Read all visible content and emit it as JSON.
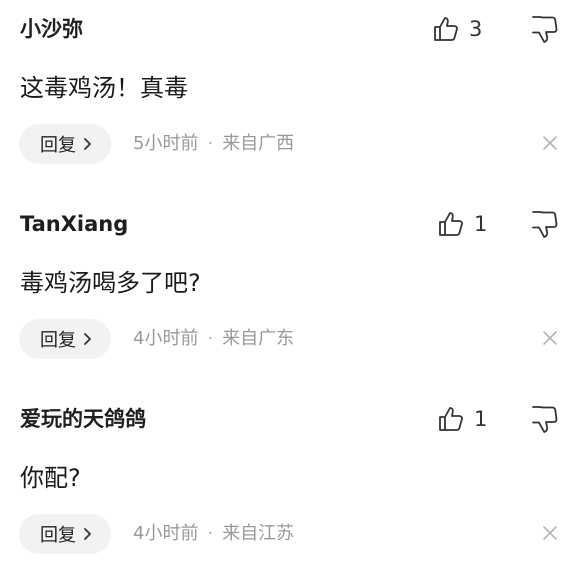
{
  "comments": [
    {
      "username": "小沙弥",
      "like_count": "3",
      "content": "这毒鸡汤！真毒",
      "reply_label": "回复",
      "time": "5小时前",
      "separator": "·",
      "location": "来自广西"
    },
    {
      "username": "TanXiang",
      "like_count": "1",
      "content": "毒鸡汤喝多了吧?",
      "reply_label": "回复",
      "time": "4小时前",
      "separator": "·",
      "location": "来自广东"
    },
    {
      "username": "爱玩的天鸽鸽",
      "like_count": "1",
      "content": "你配?",
      "reply_label": "回复",
      "time": "4小时前",
      "separator": "·",
      "location": "来自江苏"
    }
  ],
  "icons": {
    "like": "thumbs-up-icon",
    "dislike": "thumbs-down-icon",
    "reply_arrow": "chevron-right-icon",
    "close": "close-icon"
  },
  "colors": {
    "text": "#1a1a1a",
    "meta": "#999999",
    "reply_bg": "#f2f2f2",
    "icon": "#333333",
    "close": "#b5b5b5"
  }
}
